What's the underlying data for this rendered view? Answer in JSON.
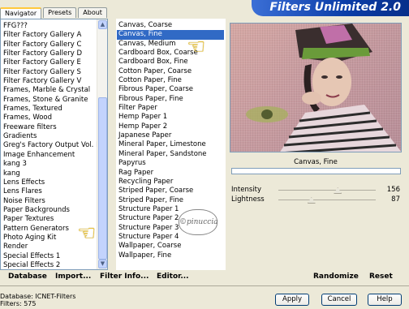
{
  "app": {
    "title": "Filters Unlimited 2.0"
  },
  "tabs": [
    {
      "label": "Navigator",
      "active": true
    },
    {
      "label": "Presets",
      "active": false
    },
    {
      "label": "About",
      "active": false
    }
  ],
  "categories": {
    "items": [
      "FFG???",
      "Filter Factory Gallery A",
      "Filter Factory Gallery C",
      "Filter Factory Gallery D",
      "Filter Factory Gallery E",
      "Filter Factory Gallery S",
      "Filter Factory Gallery V",
      "Frames, Marble & Crystal",
      "Frames, Stone & Granite",
      "Frames, Textured",
      "Frames, Wood",
      "Freeware filters",
      "Gradients",
      "Greg's Factory Output Vol. II",
      "Image Enhancement",
      "kang 3",
      "kang",
      "Lens Effects",
      "Lens Flares",
      "Noise Filters",
      "Paper Backgrounds",
      "Paper Textures",
      "Pattern Generators",
      "Photo Aging Kit",
      "Render",
      "Special Effects 1",
      "Special Effects 2"
    ],
    "selected": "Paper Textures"
  },
  "filters": {
    "items": [
      "Canvas, Coarse",
      "Canvas, Fine",
      "Canvas, Medium",
      "Cardboard Box, Coarse",
      "Cardboard Box, Fine",
      "Cotton Paper, Coarse",
      "Cotton Paper, Fine",
      "Fibrous Paper, Coarse",
      "Fibrous Paper, Fine",
      "Filter Paper",
      "Hemp Paper 1",
      "Hemp Paper 2",
      "Japanese Paper",
      "Mineral Paper, Limestone",
      "Mineral Paper, Sandstone",
      "Papyrus",
      "Rag Paper",
      "Recycling Paper",
      "Striped Paper, Coarse",
      "Striped Paper, Fine",
      "Structure Paper 1",
      "Structure Paper 2",
      "Structure Paper 3",
      "Structure Paper 4",
      "Wallpaper, Coarse",
      "Wallpaper, Fine"
    ],
    "selected": "Canvas, Fine"
  },
  "preview": {
    "label": "Canvas, Fine"
  },
  "sliders": [
    {
      "label": "Intensity",
      "value": "156",
      "fraction": 0.61
    },
    {
      "label": "Lightness",
      "value": "87",
      "fraction": 0.34
    }
  ],
  "bottom_links": {
    "database": "Database",
    "import": "Import...",
    "filter_info": "Filter Info...",
    "editor": "Editor...",
    "randomize": "Randomize",
    "reset": "Reset"
  },
  "status": {
    "database_line": "Database:  ICNET-Filters",
    "filters_line": "Filters:    575"
  },
  "dialog_buttons": {
    "apply": "Apply",
    "cancel": "Cancel",
    "help": "Help"
  },
  "watermark": "©pinuccia",
  "colors": {
    "selection": "#316ac5",
    "title_bg": "#0b3da8",
    "window_bg": "#ece9d8"
  },
  "icons": [
    "pointing-hand-icon",
    "scroll-up-arrow-icon",
    "scroll-down-arrow-icon"
  ]
}
